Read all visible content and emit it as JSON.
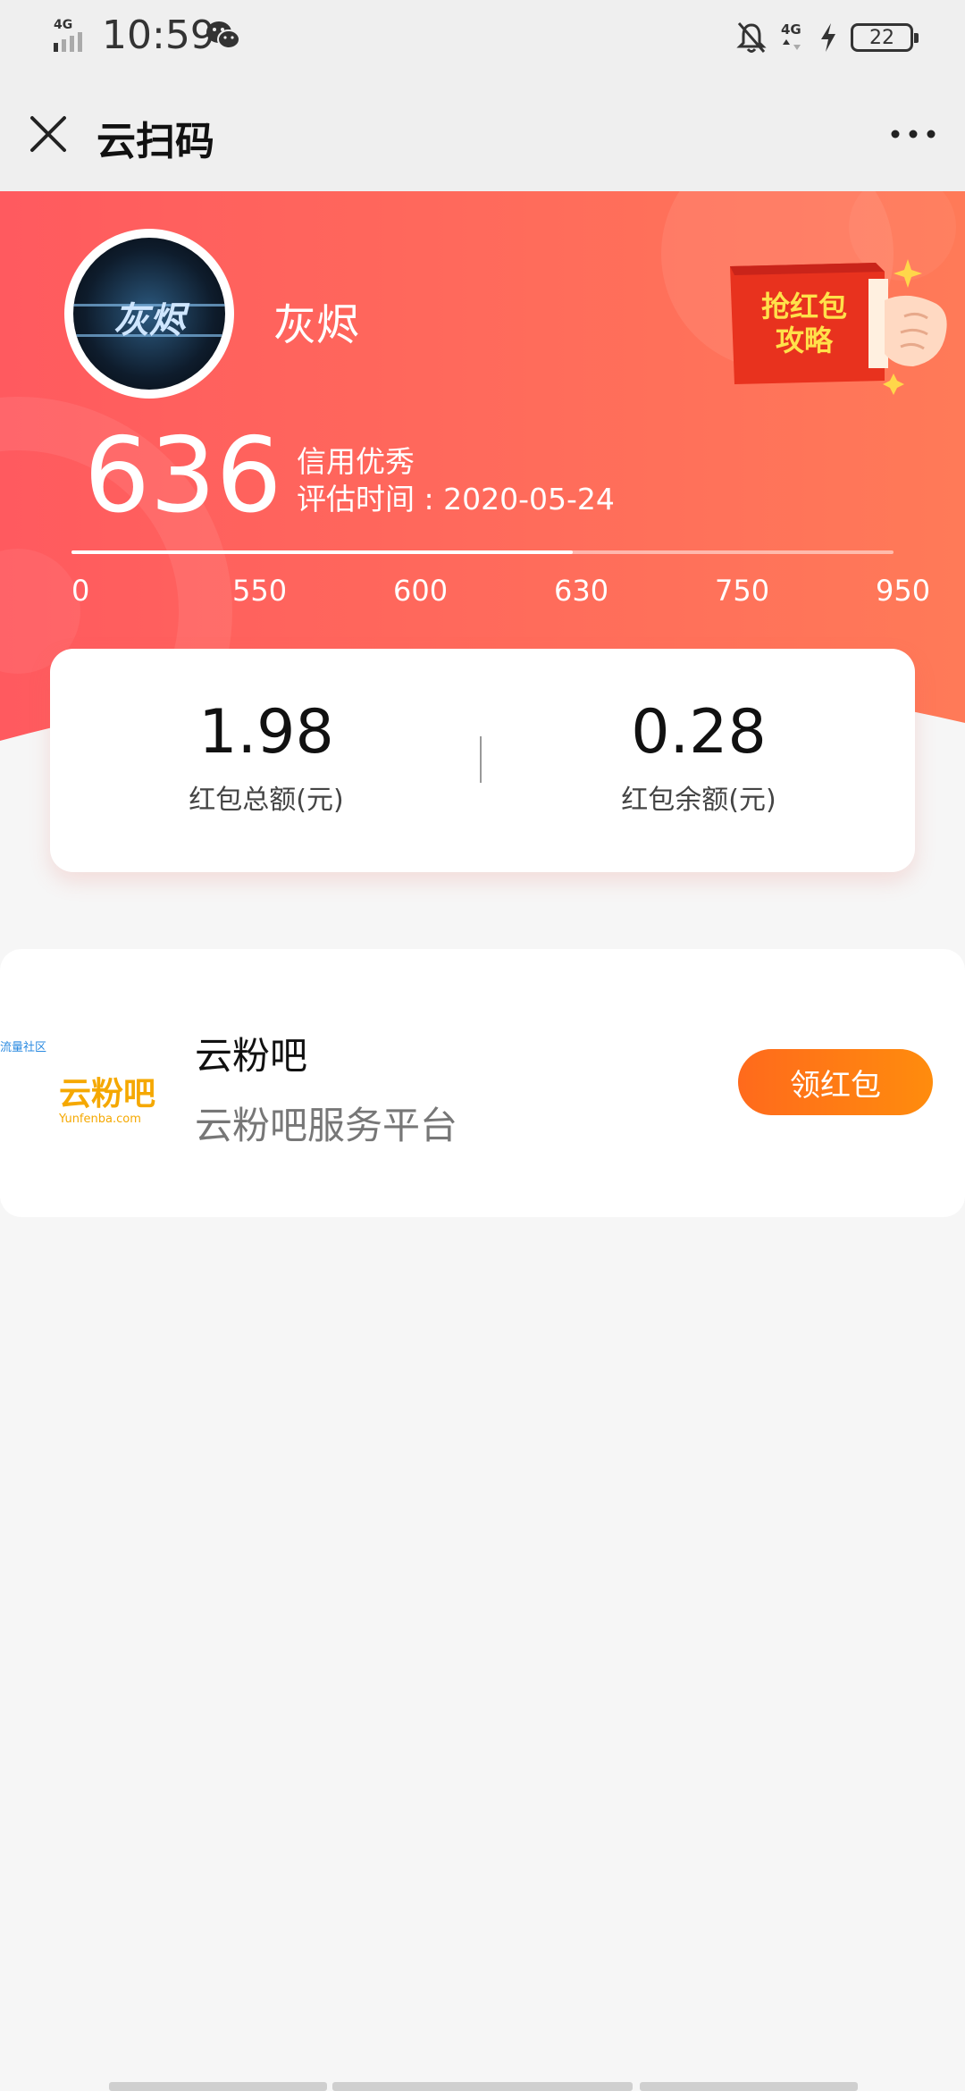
{
  "status_bar": {
    "network_left": "4G",
    "time": "10:59",
    "network_right": "4G",
    "battery": "22"
  },
  "header": {
    "title": "云扫码"
  },
  "profile": {
    "username": "灰烬",
    "avatar_text": "灰烬",
    "score": "636",
    "credit_level": "信用优秀",
    "eval_label": "评估时间 : ",
    "eval_date": "2020-05-24",
    "promo_text_line1": "抢红包",
    "promo_text_line2": "攻略",
    "score_scale": {
      "ticks": [
        "0",
        "550",
        "600",
        "630",
        "750",
        "950"
      ],
      "progress_fraction": 0.61
    }
  },
  "balance": {
    "total_value": "1.98",
    "total_label": "红包总额(元)",
    "remaining_value": "0.28",
    "remaining_label": "红包余额(元)"
  },
  "merchant": {
    "logo_caption": "流量社区",
    "logo_brand": "云粉吧",
    "logo_domain": "Yunfenba.com",
    "name": "云粉吧",
    "description": "云粉吧服务平台",
    "button_label": "领红包"
  },
  "colors": {
    "hero_start": "#ff5a5f",
    "hero_end": "#ff7a58",
    "button_orange": "#ff7a12",
    "promo_red": "#e8321e",
    "promo_yellow": "#ffe14a"
  }
}
